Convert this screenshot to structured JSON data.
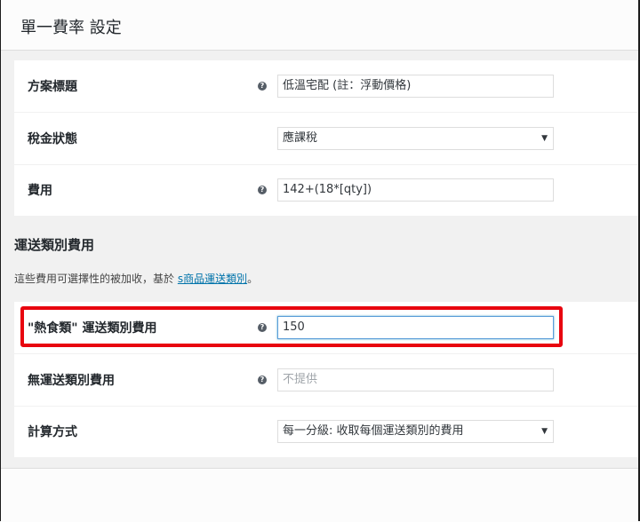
{
  "header": {
    "title": "單一費率 設定"
  },
  "fields": {
    "method_title": {
      "label": "方案標題",
      "value": "低溫宅配 (註：浮動價格)"
    },
    "tax_status": {
      "label": "稅金狀態",
      "value": "應課稅"
    },
    "cost": {
      "label": "費用",
      "value": "142+(18*[qty])"
    }
  },
  "shipping_class": {
    "title": "運送類別費用",
    "desc_prefix": "這些費用可選擇性的被加收，基於 ",
    "desc_link": "s商品運送類別",
    "desc_suffix": "。",
    "class_cost": {
      "label": "\"熱食類\" 運送類別費用",
      "value": "150"
    },
    "no_class_cost": {
      "label": "無運送類別費用",
      "placeholder": "不提供"
    },
    "calc_type": {
      "label": "計算方式",
      "value": "每一分級: 收取每個運送類別的費用"
    }
  },
  "icons": {
    "help": "help-tip-icon",
    "dropdown": "dropdown-arrow-icon"
  },
  "colors": {
    "highlight": "#e8050f",
    "link": "#0073aa"
  }
}
